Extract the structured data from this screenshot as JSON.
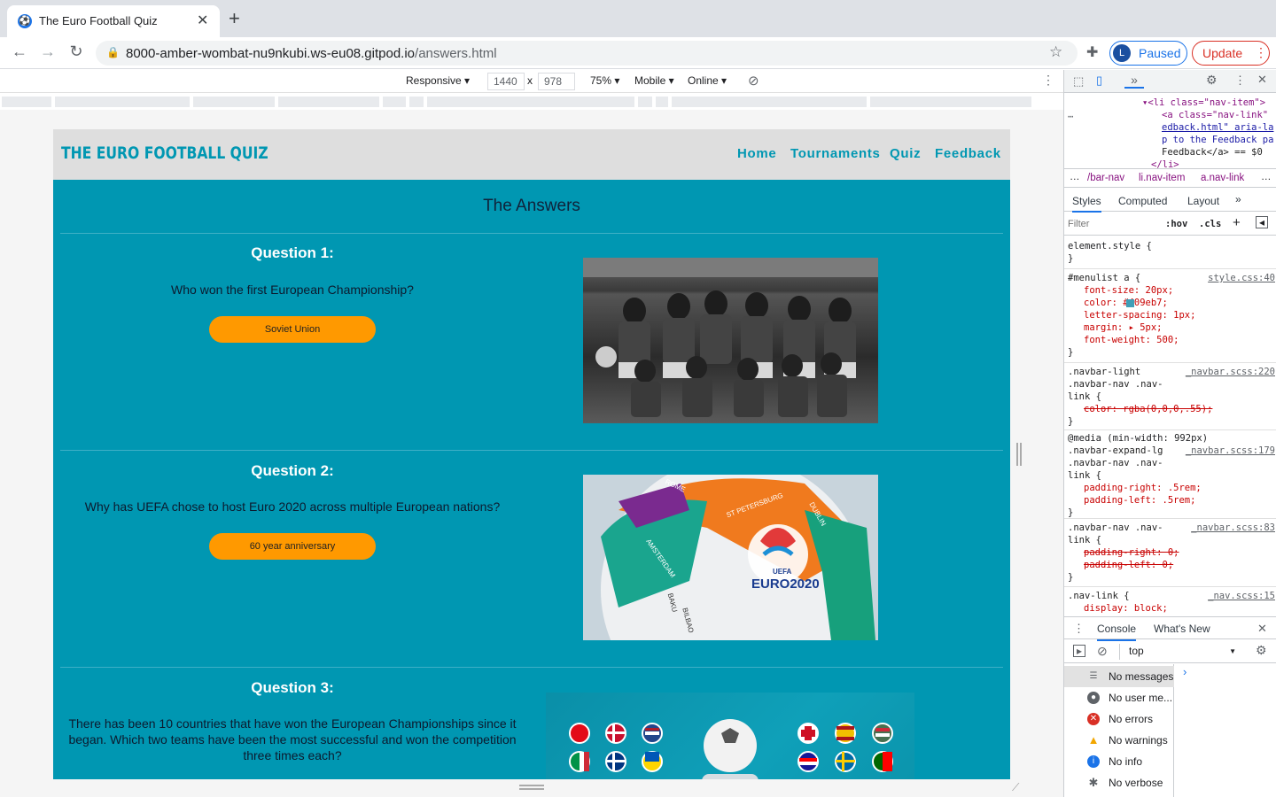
{
  "browser": {
    "tab_title": "The Euro Football Quiz",
    "new_tab": "+",
    "tab_close": "✕",
    "url_host": "8000-amber-wombat-nu9nkubi.ws-eu08.gitpod.io",
    "url_path": "/answers.html",
    "profile_initial": "L",
    "paused_label": "Paused",
    "update_label": "Update"
  },
  "device_toolbar": {
    "mode": "Responsive ▾",
    "width": "1440",
    "times": "x",
    "height": "978",
    "zoom": "75% ▾",
    "device": "Mobile ▾",
    "network": "Online ▾"
  },
  "site": {
    "brand": "THE EURO FOOTBALL QUIZ",
    "menu": [
      "Home",
      "Tournaments",
      "Quiz",
      "Feedback"
    ],
    "heading": "The Answers",
    "questions": [
      {
        "title": "Question 1:",
        "text": "Who won the first European Championship?",
        "answer": "Soviet Union"
      },
      {
        "title": "Question 2:",
        "text": "Why has UEFA chose to host Euro 2020 across multiple European nations?",
        "answer": "60 year anniversary"
      },
      {
        "title": "Question 3:",
        "text": "There has been 10 countries that have won the European Championships since it began. Which two teams have been the most successful and won the competition three times each?"
      }
    ],
    "ball_cities": [
      "ROME",
      "ST PETERSBURG",
      "DUBLIN",
      "AMSTERDAM",
      "BAKU",
      "BILBAO"
    ],
    "ball_logo": "EURO2020",
    "ball_uefa": "UEFA"
  },
  "devtools": {
    "elements_lines": [
      "▾<li class=\"nav-item\">",
      "<a class=\"nav-link\"",
      "edback.html\" aria-la",
      "p to the Feedback pa",
      "Feedback</a> == $0",
      "</li>"
    ],
    "breadcrumbs": [
      "…",
      "/bar-nav",
      "li.nav-item",
      "a.nav-link",
      "…"
    ],
    "tabs": [
      "Styles",
      "Computed",
      "Layout",
      "»"
    ],
    "filter_placeholder": "Filter",
    "hov": ":hov",
    "cls": ".cls",
    "rules": {
      "element_style": "element.style {",
      "close": "}",
      "menulist_sel": "#menulist a {",
      "menulist_src": "style.css:40",
      "menulist_props": [
        "font-size: 20px;",
        "color: #409eb7;",
        "letter-spacing: 1px;",
        "margin: ▸ 5px;",
        "font-weight: 500;"
      ],
      "navlight_sel": ".navbar-light .navbar-nav .nav-link {",
      "navlight_src": "_navbar.scss:220",
      "navlight_prop": "color: rgba(0,0,0,.55);",
      "media": "@media (min-width: 992px)",
      "expand_sel": ".navbar-expand-lg .navbar-nav .nav-link {",
      "expand_src": "_navbar.scss:179",
      "expand_props": [
        "padding-right: .5rem;",
        "padding-left: .5rem;"
      ],
      "nav_sel": ".navbar-nav .nav-link {",
      "nav_src": "_navbar.scss:83",
      "nav_props": [
        "padding-right: 0;",
        "padding-left: 0;"
      ],
      "navlink_sel": ".nav-link {",
      "navlink_src": "_nav.scss:15",
      "navlink_prop": "display: block;"
    },
    "console_tabs": [
      "Console",
      "What's New"
    ],
    "context": "top",
    "console_items": [
      "No messages",
      "No user me...",
      "No errors",
      "No warnings",
      "No info",
      "No verbose"
    ],
    "colors": {
      "accent": "#0097b2",
      "answer": "#ff9900",
      "swatch": "#409eb7"
    }
  }
}
